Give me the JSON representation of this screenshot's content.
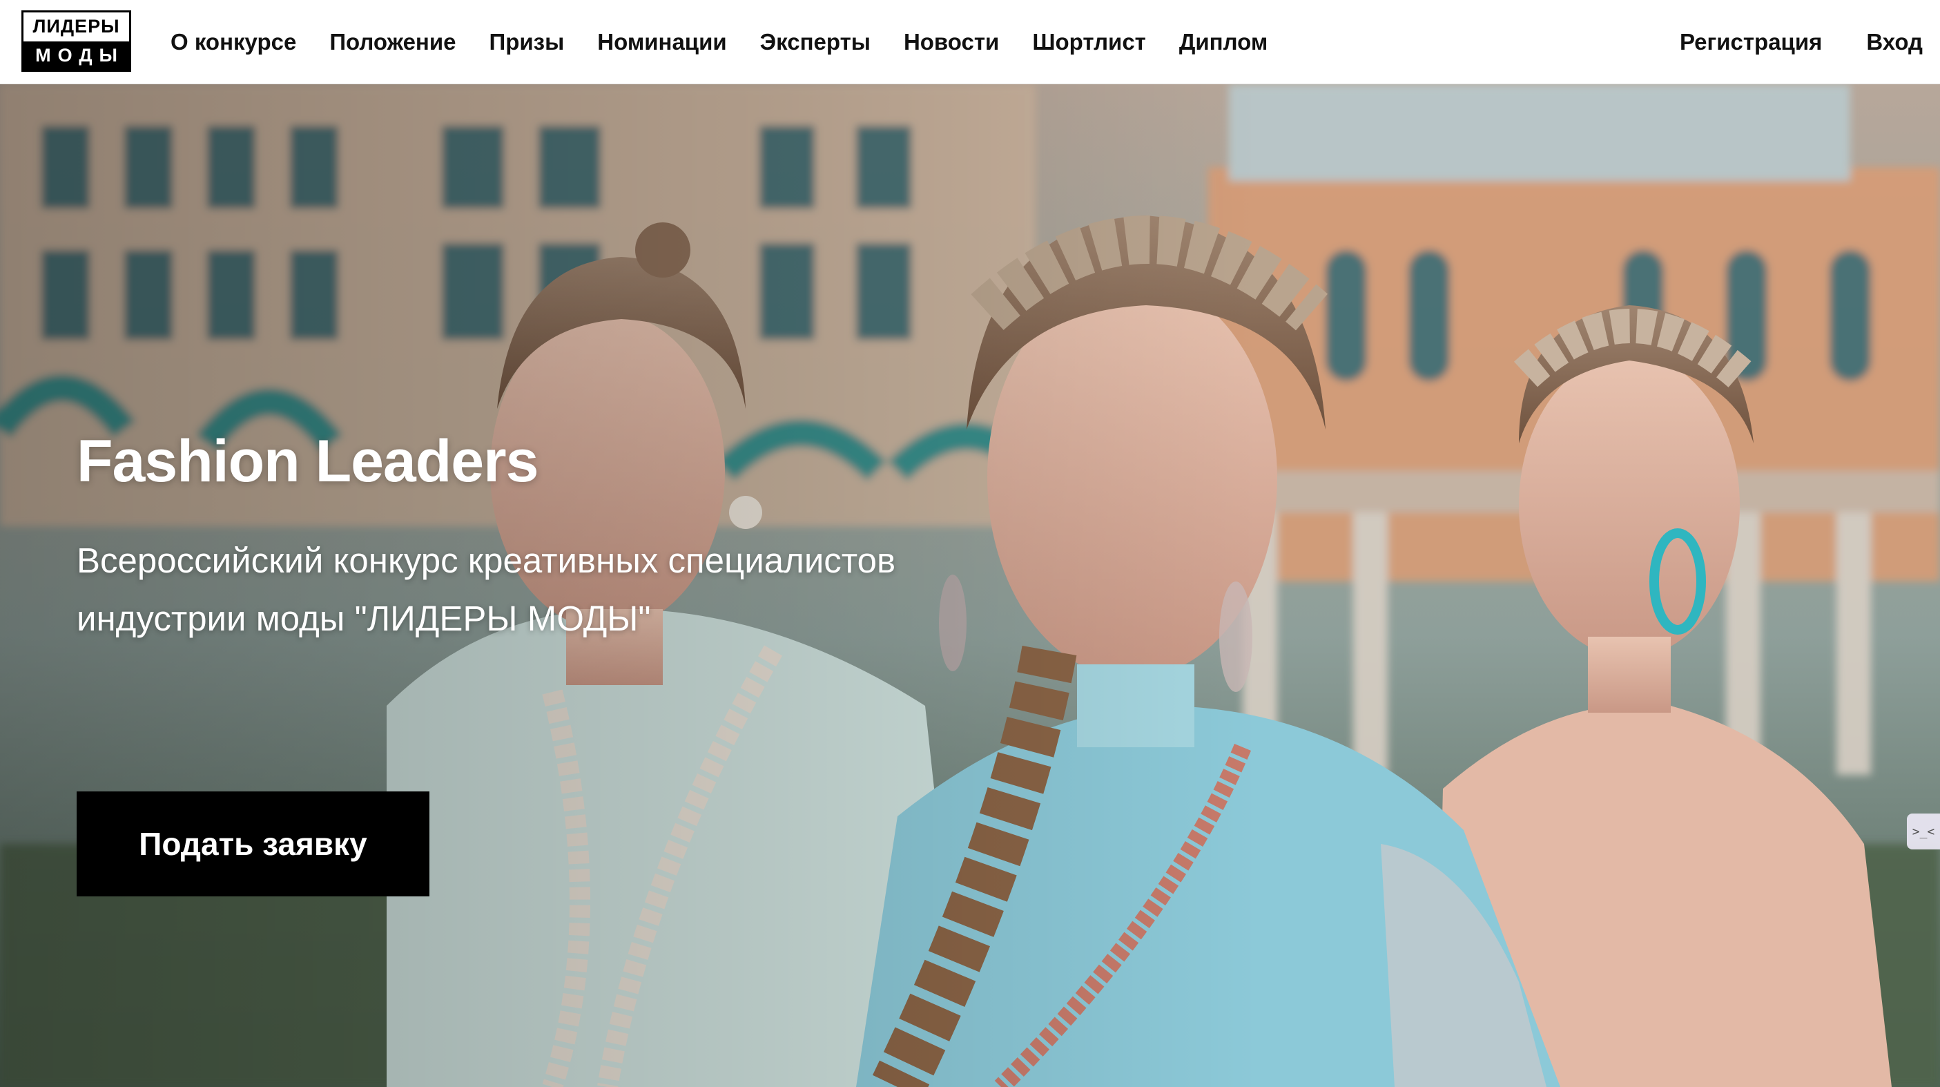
{
  "logo": {
    "line1": "ЛИДЕРЫ",
    "line2": "МОДЫ"
  },
  "nav": {
    "items": [
      {
        "label": "О конкурсе"
      },
      {
        "label": "Положение"
      },
      {
        "label": "Призы"
      },
      {
        "label": "Номинации"
      },
      {
        "label": "Эксперты"
      },
      {
        "label": "Новости"
      },
      {
        "label": "Шортлист"
      },
      {
        "label": "Диплом"
      }
    ],
    "register": "Регистрация",
    "login": "Вход"
  },
  "hero": {
    "title": "Fashion Leaders",
    "subtitle": "Всероссийский конкурс креативных специалистов индустрии моды \"ЛИДЕРЫ МОДЫ\"",
    "apply_button": "Подать заявку",
    "image_icon": "fashion-models-photo"
  },
  "widget": {
    "icon": "code-icon",
    "glyph": ">_<"
  },
  "colors": {
    "accent": "#000000",
    "text_on_hero": "#ffffff"
  }
}
